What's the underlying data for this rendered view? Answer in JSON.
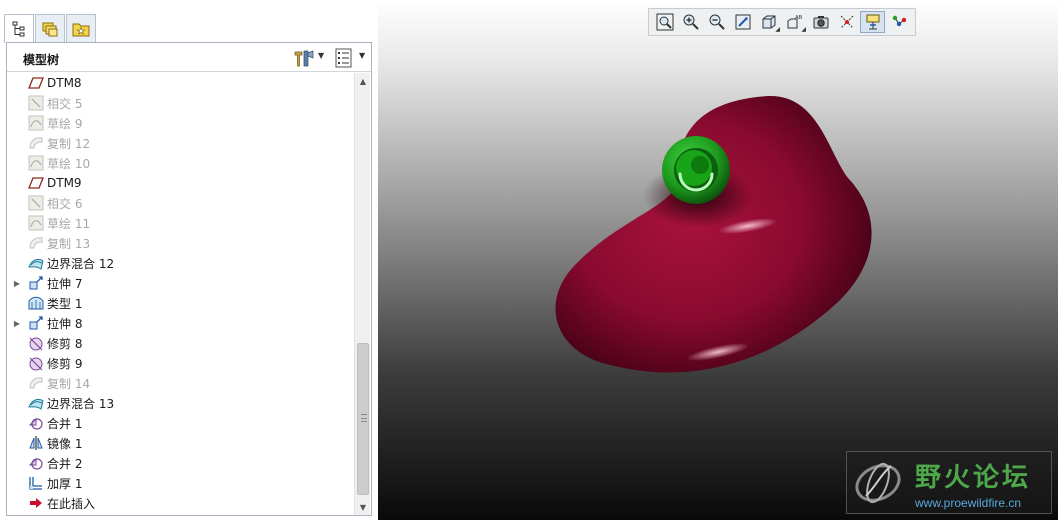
{
  "tree": {
    "title": "模型树",
    "items": [
      {
        "label": "DTM8",
        "icon": "datum-plane-icon",
        "dim": false,
        "expand": ""
      },
      {
        "label": "相交 5",
        "icon": "intersect-icon",
        "dim": true,
        "expand": ""
      },
      {
        "label": "草绘 9",
        "icon": "sketch-icon",
        "dim": true,
        "expand": ""
      },
      {
        "label": "复制 12",
        "icon": "copy-icon",
        "dim": true,
        "expand": ""
      },
      {
        "label": "草绘 10",
        "icon": "sketch-icon",
        "dim": true,
        "expand": ""
      },
      {
        "label": "DTM9",
        "icon": "datum-plane-icon",
        "dim": false,
        "expand": ""
      },
      {
        "label": "相交 6",
        "icon": "intersect-icon",
        "dim": true,
        "expand": ""
      },
      {
        "label": "草绘 11",
        "icon": "sketch-icon",
        "dim": true,
        "expand": ""
      },
      {
        "label": "复制 13",
        "icon": "copy-icon",
        "dim": true,
        "expand": ""
      },
      {
        "label": "边界混合 12",
        "icon": "boundary-blend-icon",
        "dim": false,
        "expand": ""
      },
      {
        "label": "拉伸 7",
        "icon": "extrude-icon",
        "dim": false,
        "expand": "▶"
      },
      {
        "label": "类型 1",
        "icon": "style-icon",
        "dim": false,
        "expand": ""
      },
      {
        "label": "拉伸 8",
        "icon": "extrude-icon",
        "dim": false,
        "expand": "▶"
      },
      {
        "label": "修剪 8",
        "icon": "trim-icon",
        "dim": false,
        "expand": ""
      },
      {
        "label": "修剪 9",
        "icon": "trim-icon",
        "dim": false,
        "expand": ""
      },
      {
        "label": "复制 14",
        "icon": "copy-icon",
        "dim": true,
        "expand": ""
      },
      {
        "label": "边界混合 13",
        "icon": "boundary-blend-icon",
        "dim": false,
        "expand": ""
      },
      {
        "label": "合并 1",
        "icon": "merge-icon",
        "dim": false,
        "expand": ""
      },
      {
        "label": "镜像 1",
        "icon": "mirror-icon",
        "dim": false,
        "expand": ""
      },
      {
        "label": "合并 2",
        "icon": "merge-icon",
        "dim": false,
        "expand": ""
      },
      {
        "label": "加厚 1",
        "icon": "thicken-icon",
        "dim": false,
        "expand": ""
      },
      {
        "label": "在此插入",
        "icon": "insert-here-icon",
        "dim": false,
        "expand": ""
      }
    ]
  },
  "toolbar": {
    "buttons": [
      "refit-icon",
      "zoom-in-icon",
      "zoom-out-icon",
      "repaint-icon",
      "display-style-icon",
      "saved-views-icon",
      "view-manager-icon",
      "datum-display-icon",
      "spin-center-icon",
      "annotation-display-icon"
    ]
  },
  "watermark": {
    "cn": "野火论坛",
    "url": "www.proewildfire.cn"
  },
  "colors": {
    "model_body": "#8a0a30",
    "model_boss": "#1e9a1e",
    "panel_border": "#aab4c0"
  }
}
